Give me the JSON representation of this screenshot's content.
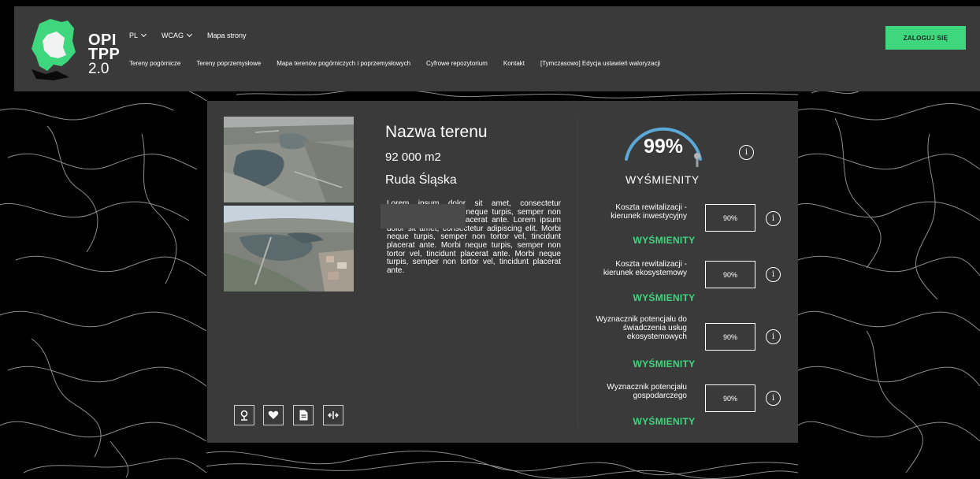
{
  "colors": {
    "accent": "#3ed77e",
    "header_bg": "#3a3a3a",
    "card_bg": "#3a3a3a",
    "page_bg": "#000000",
    "gauge_arc": "#5aa9d6"
  },
  "logo": {
    "line1": "OPI",
    "line2": "TPP",
    "line3": "2.0"
  },
  "topnav": {
    "language": "PL",
    "wcag": "WCAG",
    "sitemap": "Mapa strony"
  },
  "mainnav": [
    {
      "label": "Tereny pogórnicze"
    },
    {
      "label": "Tereny poprzemysłowe"
    },
    {
      "label": "Mapa terenów pogórniczych i poprzemysłowych"
    },
    {
      "label": "Cyfrowe repozytorium"
    },
    {
      "label": "Kontakt"
    },
    {
      "label": "[Tymczasowo] Edycja ustawień waloryzacji"
    }
  ],
  "login": {
    "label": "ZALOGUJ SIĘ"
  },
  "site": {
    "title": "Nazwa terenu",
    "area": "92 000 m2",
    "city": "Ruda Śląska",
    "description": "Lorem ipsum dolor sit amet, consectetur adipiscing elit. Morbi neque turpis, semper non tortor vel, tincidunt placerat ante. Lorem ipsum dolor sit amet, consectetur adipiscing elit. Morbi neque turpis, semper non tortor vel, tincidunt placerat ante. Morbi neque turpis, semper non tortor vel, tincidunt placerat ante. Morbi neque turpis, semper non tortor vel, tincidunt placerat ante."
  },
  "actions": [
    {
      "icon": "map-pin-icon"
    },
    {
      "icon": "heart-icon"
    },
    {
      "icon": "document-icon"
    },
    {
      "icon": "compare-icon"
    }
  ],
  "overall": {
    "score_text": "99%",
    "score": 0.99,
    "rating": "WYŚMIENITY",
    "info": "i"
  },
  "metrics": [
    {
      "label": "Koszta rewitalizacji - kierunek inwestycyjny",
      "value": "90%",
      "rating": "WYŚMIENITY",
      "info": "i"
    },
    {
      "label": "Koszta rewitalizacji - kierunek ekosystemowy",
      "value": "90%",
      "rating": "WYŚMIENITY",
      "info": "i"
    },
    {
      "label": "Wyznacznik potencjału do świadczenia usług ekosystemowych",
      "value": "90%",
      "rating": "WYŚMIENITY",
      "info": "i"
    },
    {
      "label": "Wyznacznik potencjału gospodarczego",
      "value": "90%",
      "rating": "WYŚMIENITY",
      "info": "i"
    }
  ]
}
